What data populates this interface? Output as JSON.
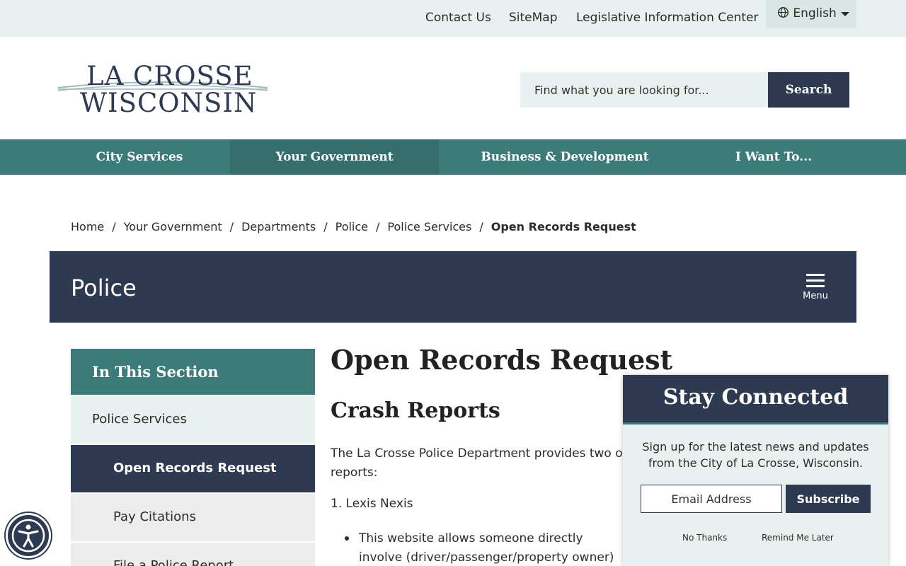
{
  "utility": {
    "links": [
      "Contact Us",
      "SiteMap",
      "Legislative Information Center"
    ],
    "language": "English"
  },
  "logo": {
    "line1": "LA CROSSE",
    "line2": "WISCONSIN"
  },
  "search": {
    "placeholder": "Find what you are looking for...",
    "button": "Search"
  },
  "nav": [
    "City Services",
    "Your Government",
    "Business & Development",
    "I Want To..."
  ],
  "nav_active": "Your Government",
  "breadcrumb": [
    "Home",
    "Your Government",
    "Departments",
    "Police",
    "Police Services",
    "Open Records Request"
  ],
  "banner": {
    "title": "Police",
    "menu_label": "Menu"
  },
  "sidebar": {
    "heading": "In This Section",
    "items": [
      "Police Services",
      "Open Records Request",
      "Pay Citations",
      "File a Police Report"
    ]
  },
  "content": {
    "title": "Open Records Request",
    "subtitle": "Crash Reports",
    "paragraph": "The La Crosse Police Department provides two or reports:",
    "list_item": "1. Lexis Nexis",
    "bullet": "This website allows someone directly involve (driver/passenger/property owner) to downlo"
  },
  "popup": {
    "title": "Stay Connected",
    "text": "Sign up for the latest news and updates from the City of La Crosse, Wisconsin.",
    "email_placeholder": "Email Address",
    "subscribe": "Subscribe",
    "no_thanks": "No Thanks",
    "remind": "Remind Me Later"
  },
  "colors": {
    "navy": "#2e3a52",
    "teal": "#3d7b7a",
    "light": "#e9f1f0"
  }
}
